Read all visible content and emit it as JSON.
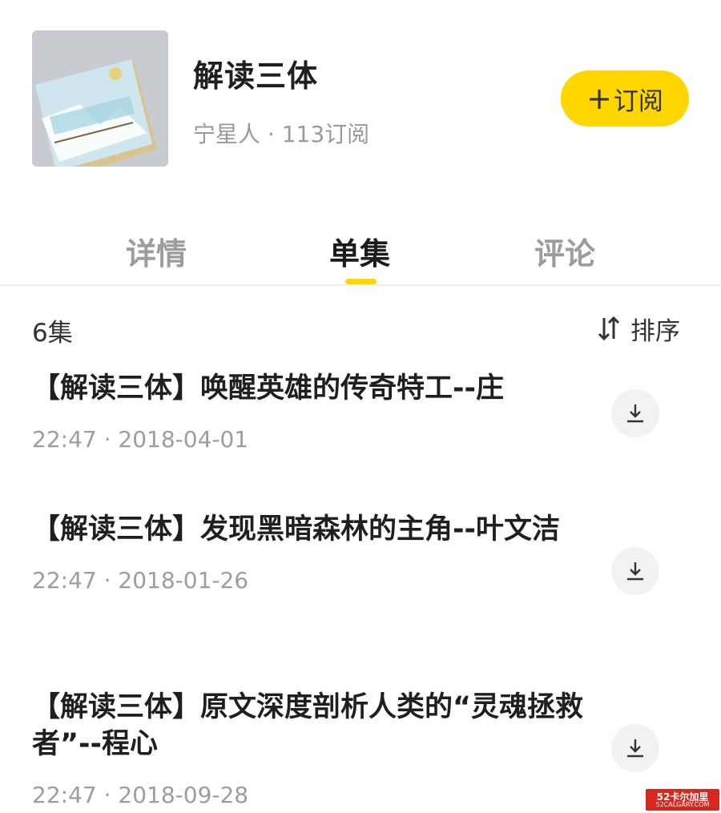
{
  "header": {
    "title": "解读三体",
    "meta": "宁星人 · 113订阅",
    "cover_icon": "book-cover",
    "subscribe_plus": "+",
    "subscribe_label": "订阅"
  },
  "tabs": [
    {
      "label": "详情",
      "active": false
    },
    {
      "label": "单集",
      "active": true
    },
    {
      "label": "评论",
      "active": false
    }
  ],
  "list": {
    "count": "6集",
    "sort_icon": "sort-icon",
    "sort_label": "排序"
  },
  "episodes": [
    {
      "title": "【解读三体】唤醒英雄的传奇特工--庄",
      "meta": "22:47 · 2018-04-01"
    },
    {
      "title": "【解读三体】发现黑暗森林的主角--叶文洁",
      "meta": "22:47 · 2018-01-26"
    },
    {
      "title": "【解读三体】原文深度剖析人类的“灵魂拯救者”--程心",
      "meta": "22:47 · 2018-09-28"
    }
  ],
  "watermark": {
    "line1": "52卡尔加里",
    "line2": "52CALGARY.COM"
  },
  "colors": {
    "accent": "#ffd600",
    "text": "#222222",
    "muted": "#9a9a9a",
    "watermark": "#d6281e"
  }
}
